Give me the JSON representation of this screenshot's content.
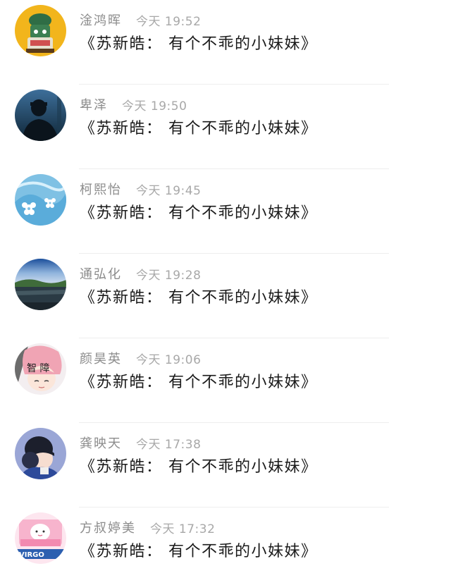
{
  "feed": {
    "items": [
      {
        "name": "淦鸿晖",
        "time": "今天 19:52",
        "message": "《苏新皓： 有个不乖的小妹妹》",
        "avatar": "cartoon-character-avatar-icon"
      },
      {
        "name": "卑泽",
        "time": "今天 19:50",
        "message": "《苏新皓： 有个不乖的小妹妹》",
        "avatar": "silhouette-person-avatar-icon"
      },
      {
        "name": "柯熙怡",
        "time": "今天 19:45",
        "message": "《苏新皓： 有个不乖的小妹妹》",
        "avatar": "blue-flower-avatar-icon"
      },
      {
        "name": "通弘化",
        "time": "今天 19:28",
        "message": "《苏新皓： 有个不乖的小妹妹》",
        "avatar": "landscape-avatar-icon"
      },
      {
        "name": "颜昊英",
        "time": "今天 19:06",
        "message": "《苏新皓： 有个不乖的小妹妹》",
        "avatar": "anime-girl-avatar-icon",
        "avatar_text": "智 障"
      },
      {
        "name": "龚映天",
        "time": "今天 17:38",
        "message": "《苏新皓： 有个不乖的小妹妹》",
        "avatar": "couple-cartoon-avatar-icon"
      },
      {
        "name": "方叔婷美",
        "time": "今天 17:32",
        "message": "《苏新皓： 有个不乖的小妹妹》",
        "avatar": "virgo-sticker-avatar-icon",
        "avatar_text": "VIRGO"
      }
    ]
  }
}
